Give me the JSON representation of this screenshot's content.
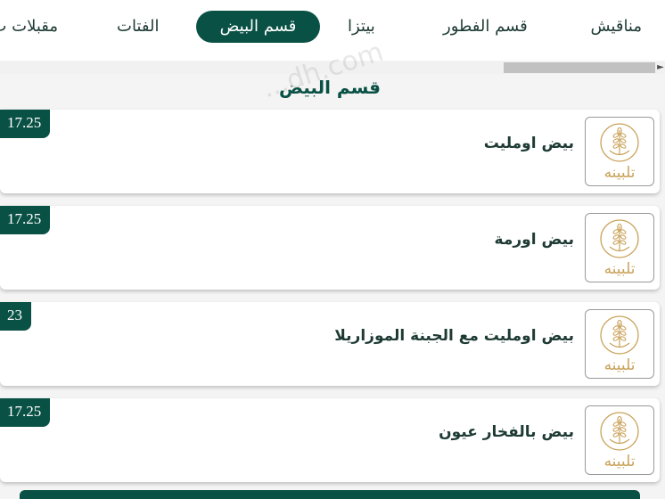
{
  "categories": [
    {
      "label": "مناقيش",
      "active": false
    },
    {
      "label": "قسم الفطور",
      "active": false
    },
    {
      "label": "بيتزا",
      "active": false
    },
    {
      "label": "قسم البيض",
      "active": true
    },
    {
      "label": "الفتات",
      "active": false
    },
    {
      "label": "مقبلات ب",
      "active": false
    }
  ],
  "section": {
    "title": "قسم البيض"
  },
  "watermark": "...dh.com",
  "brand": {
    "logo_text": "تلبينه",
    "gold_color": "#c9a25a"
  },
  "colors": {
    "primary": "#0a5145"
  },
  "items": [
    {
      "name": "بيض اومليت",
      "price": "17.25"
    },
    {
      "name": "بيض اورمة",
      "price": "17.25"
    },
    {
      "name": "بيض اومليت مع الجبنة الموزاريلا",
      "price": "23"
    },
    {
      "name": "بيض بالفخار عيون",
      "price": "17.25"
    }
  ],
  "scrollbar": {
    "arrow": "►"
  }
}
